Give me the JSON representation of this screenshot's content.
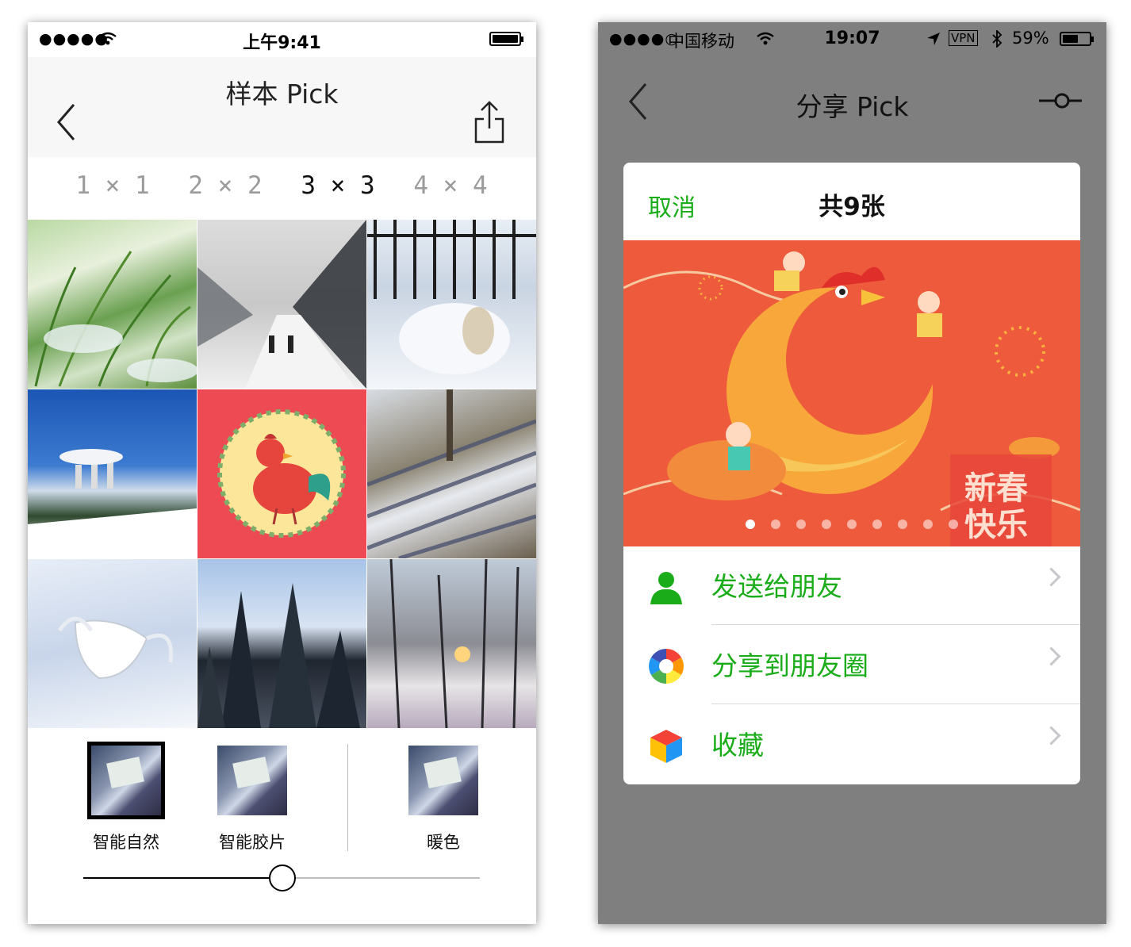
{
  "left_phone": {
    "status": {
      "signal": "●●●●●",
      "time": "上午9:41"
    },
    "title": "样本 Pick",
    "grid_options": [
      "1 × 1",
      "2 × 2",
      "3 × 3",
      "4 × 4"
    ],
    "selected_grid": "3 × 3",
    "filters": [
      "智能自然",
      "智能胶片",
      "暖色"
    ],
    "selected_filter": "智能自然",
    "slider_value_percent": 50
  },
  "right_phone": {
    "status": {
      "signal": "●●●●○",
      "carrier": "中国移动",
      "time": "19:07",
      "vpn": "VPN",
      "battery": "59%"
    },
    "title": "分享 Pick",
    "sheet": {
      "cancel": "取消",
      "count": "共9张",
      "banner_text_line1": "新春",
      "banner_text_line2": "快乐",
      "page_count": 9,
      "current_page": 1,
      "actions": [
        {
          "label": "发送给朋友",
          "icon": "contact-person-icon"
        },
        {
          "label": "分享到朋友圈",
          "icon": "moments-aperture-icon"
        },
        {
          "label": "收藏",
          "icon": "favorites-cube-icon"
        }
      ]
    }
  },
  "colors": {
    "wechat_green": "#1aad19",
    "banner_red": "#ee5a3c",
    "dim_background": "#7f7f7f"
  }
}
